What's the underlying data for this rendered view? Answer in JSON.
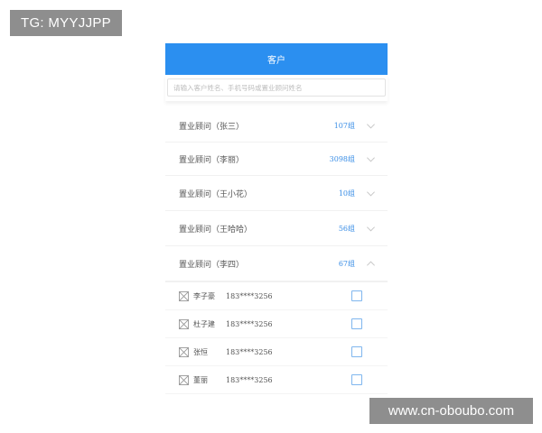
{
  "watermarks": {
    "top_left": "TG: MYYJJPP",
    "bottom_right": "www.cn-oboubo.com"
  },
  "header": {
    "title": "客户"
  },
  "search": {
    "placeholder": "请输入客户姓名、手机号码或置业顾问姓名"
  },
  "groups": [
    {
      "name": "置业顾问（张三）",
      "count": "107组",
      "expanded": false,
      "chevron": "chevron-down-icon"
    },
    {
      "name": "置业顾问（李丽）",
      "count": "3098组",
      "expanded": false,
      "chevron": "chevron-down-icon"
    },
    {
      "name": "置业顾问（王小花）",
      "count": "10组",
      "expanded": false,
      "chevron": "chevron-down-icon"
    },
    {
      "name": "置业顾问（王哈哈）",
      "count": "56组",
      "expanded": false,
      "chevron": "chevron-down-icon"
    },
    {
      "name": "置业顾问（李四）",
      "count": "67组",
      "expanded": true,
      "chevron": "chevron-up-icon"
    }
  ],
  "members": [
    {
      "name": "李子豪",
      "phone": "183****3256",
      "checked": false,
      "avatar_icon": "broken-image-icon"
    },
    {
      "name": "杜子建",
      "phone": "183****3256",
      "checked": false,
      "avatar_icon": "broken-image-icon"
    },
    {
      "name": "张恒",
      "phone": "183****3256",
      "checked": false,
      "avatar_icon": "broken-image-icon"
    },
    {
      "name": "董丽",
      "phone": "183****3256",
      "checked": false,
      "avatar_icon": "broken-image-icon"
    }
  ],
  "colors": {
    "header_bg": "#2b8ff0",
    "accent": "#3a8ee6",
    "checkbox_border": "#7fb6ee",
    "watermark_bg": "#8e8e8e"
  }
}
